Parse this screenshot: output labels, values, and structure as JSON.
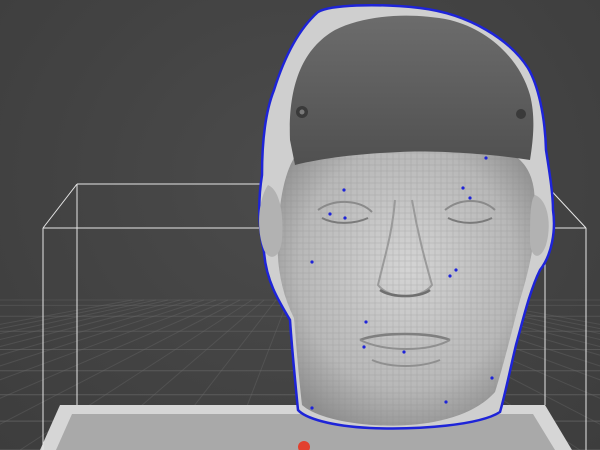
{
  "viewport": {
    "background_color": "#434343",
    "grid_color": "#6a6a6a",
    "bounding_box_color": "#e6e6e6",
    "build_plate_color": "#d6d6d6",
    "build_plate_inner_color": "#a9a9a9",
    "model_color": "#bdbdbd",
    "cap_color": "#5a5a5a",
    "selection_outline_color": "#1e24d8",
    "origin_marker_color": "#e2402e"
  },
  "model": {
    "type": "3d-scanned-head",
    "state": "selected",
    "icon": "head-model"
  },
  "markers": {
    "origin": "origin-marker-icon"
  }
}
